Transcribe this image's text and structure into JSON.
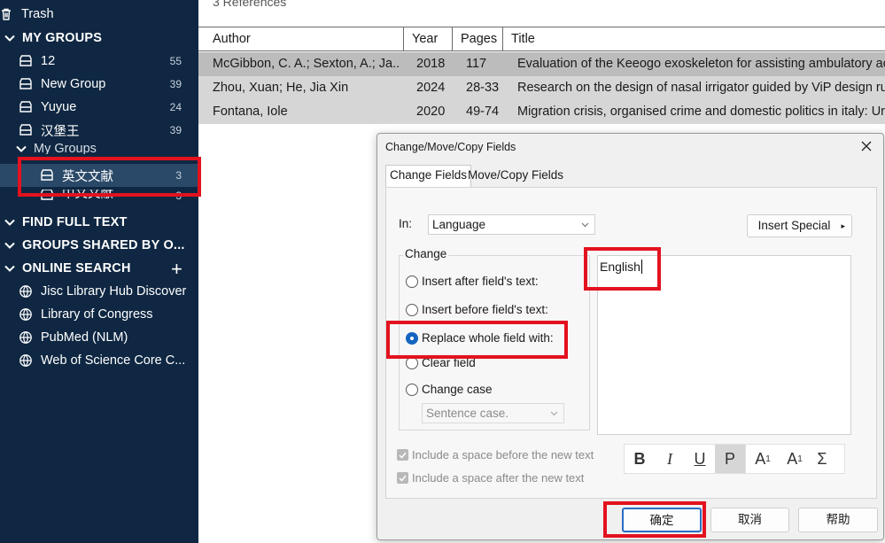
{
  "sidebar": {
    "trash": "Trash",
    "my_groups": "MY GROUPS",
    "groups": [
      {
        "label": "12",
        "count": "55"
      },
      {
        "label": "New Group",
        "count": "39"
      },
      {
        "label": "Yuyue",
        "count": "24"
      },
      {
        "label": "汉堡王",
        "count": "39"
      }
    ],
    "my_groups_set": "My Groups",
    "sub_groups": [
      {
        "label": "英文文献",
        "count": "3"
      },
      {
        "label": "中文文献",
        "count": "3"
      }
    ],
    "find_full_text": "FIND FULL TEXT",
    "groups_shared": "GROUPS SHARED BY O...",
    "online_search": "ONLINE SEARCH",
    "online_items": [
      "Jisc Library Hub Discover",
      "Library of Congress",
      "PubMed (NLM)",
      "Web of Science Core C..."
    ]
  },
  "references": {
    "count_label": "3 References",
    "columns": {
      "author": "Author",
      "year": "Year",
      "pages": "Pages",
      "title": "Title"
    },
    "rows": [
      {
        "author": "McGibbon, C. A.; Sexton, A.; Ja...",
        "year": "2018",
        "pages": "117",
        "title": "Evaluation of the Keeogo exoskeleton for assisting ambulatory ac"
      },
      {
        "author": "Zhou, Xuan; He, Jia Xin",
        "year": "2024",
        "pages": "28-33",
        "title": "Research on the design of nasal irrigator guided by ViP design ru"
      },
      {
        "author": "Fontana, Iole",
        "year": "2020",
        "pages": "49-74",
        "title": "Migration crisis, organised crime and domestic politics in italy: Ur"
      }
    ]
  },
  "dialog": {
    "title": "Change/Move/Copy Fields",
    "tabs": [
      "Change Fields",
      "Move/Copy Fields"
    ],
    "in_label": "In:",
    "in_value": "Language",
    "insert_special": "Insert Special",
    "change_group": "Change",
    "options": [
      "Insert after field's text:",
      "Insert before field's text:",
      "Replace whole field with:",
      "Clear field",
      "Change case"
    ],
    "case_value": "Sentence case.",
    "text_value": "English",
    "checks": [
      "Include a space before the new text",
      "Include a space after the new text"
    ],
    "format": [
      "B",
      "I",
      "U",
      "P",
      "A",
      "1",
      "A",
      "1",
      "Σ"
    ],
    "ok": "确定",
    "cancel": "取消",
    "help": "帮助"
  },
  "colors": {
    "sidebar_bg": "#0f2742",
    "highlight": "#e3121e",
    "radio_on": "#1565c0"
  }
}
